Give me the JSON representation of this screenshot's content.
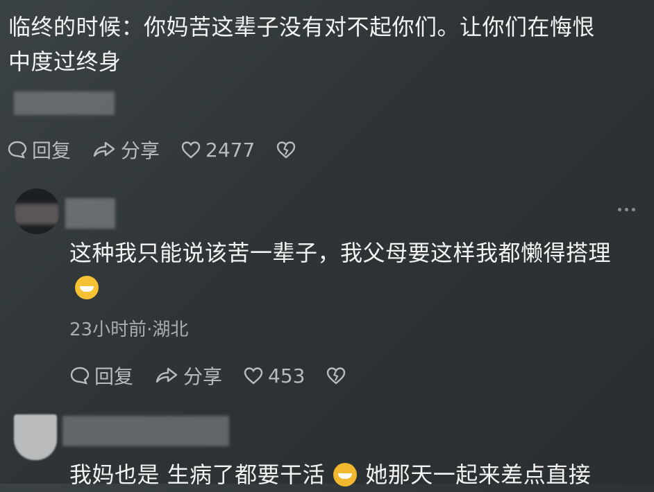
{
  "comments": [
    {
      "text_lines": [
        "临终的时候：你妈苦这辈子没有对不起你们。让你们在悔恨",
        "中度过终身"
      ],
      "actions": {
        "reply": "回复",
        "share": "分享",
        "likes": "2477"
      }
    },
    {
      "text_line1": "这种我只能说该苦一辈子，我父母要这样我都懒得搭理",
      "emoji_icon": "grinning-sweat-emoji-icon",
      "meta": "23小时前·湖北",
      "more_icon": "more-dots-icon",
      "actions": {
        "reply": "回复",
        "share": "分享",
        "likes": "453"
      }
    },
    {
      "text_line1_part1": "我妈也是 生病了都要干活",
      "emoji_icon": "crying-emoji-icon",
      "text_line1_part2": "她那天一起来差点直接"
    }
  ],
  "colors": {
    "accent_text": "#f4f4f4",
    "muted": "#a9adb0"
  }
}
